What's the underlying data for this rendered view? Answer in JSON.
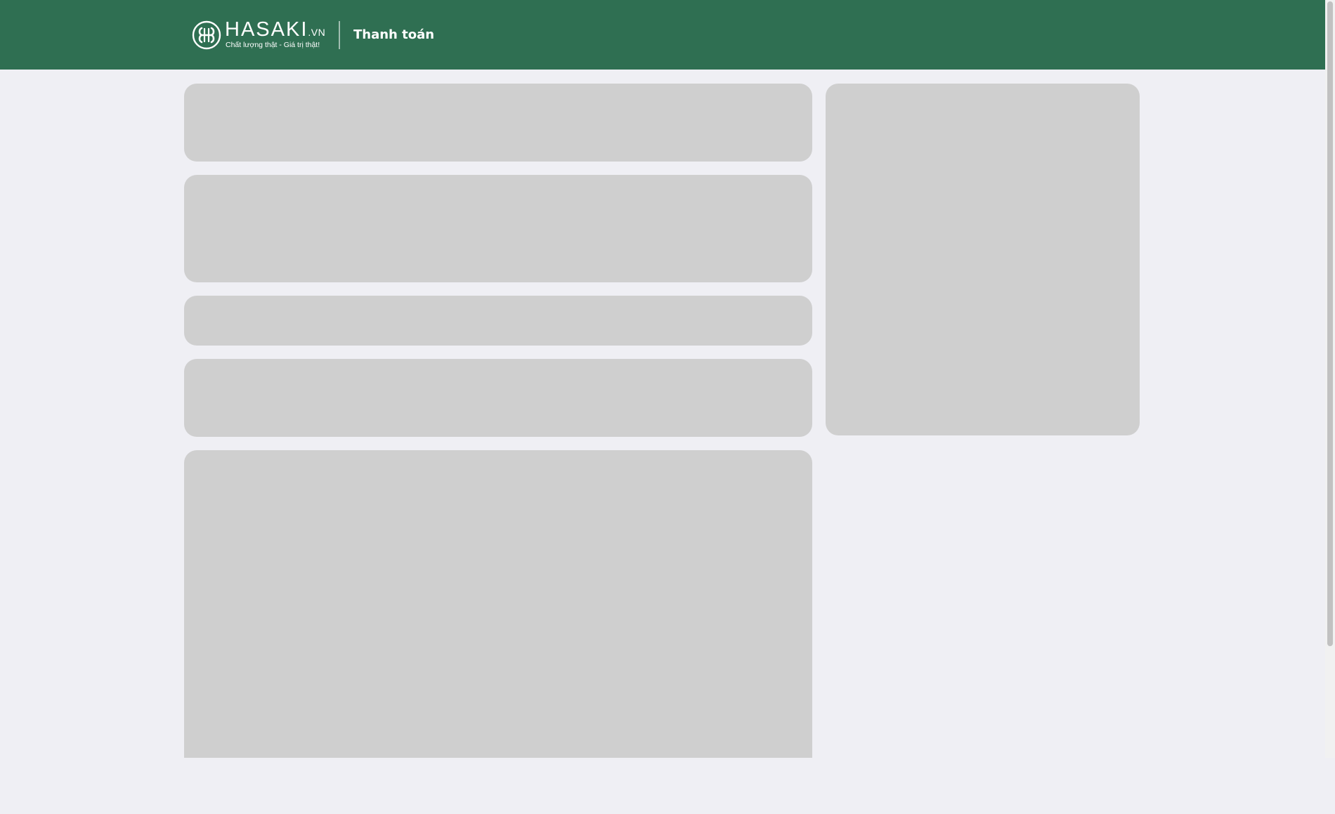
{
  "header": {
    "brand": {
      "name": "HASAKI",
      "tld": ".VN",
      "tagline": "Chất lượng thật - Giá trị thật!",
      "logo_icon": "hasaki-logo-icon"
    },
    "page_title": "Thanh toán"
  },
  "main": {
    "loading_placeholders": 5,
    "sidebar_loading_placeholders": 1
  },
  "colors": {
    "header_background": "#2f6f52",
    "page_background": "#efeff4",
    "skeleton": "#cfcfcf",
    "header_text": "#ffffff"
  }
}
